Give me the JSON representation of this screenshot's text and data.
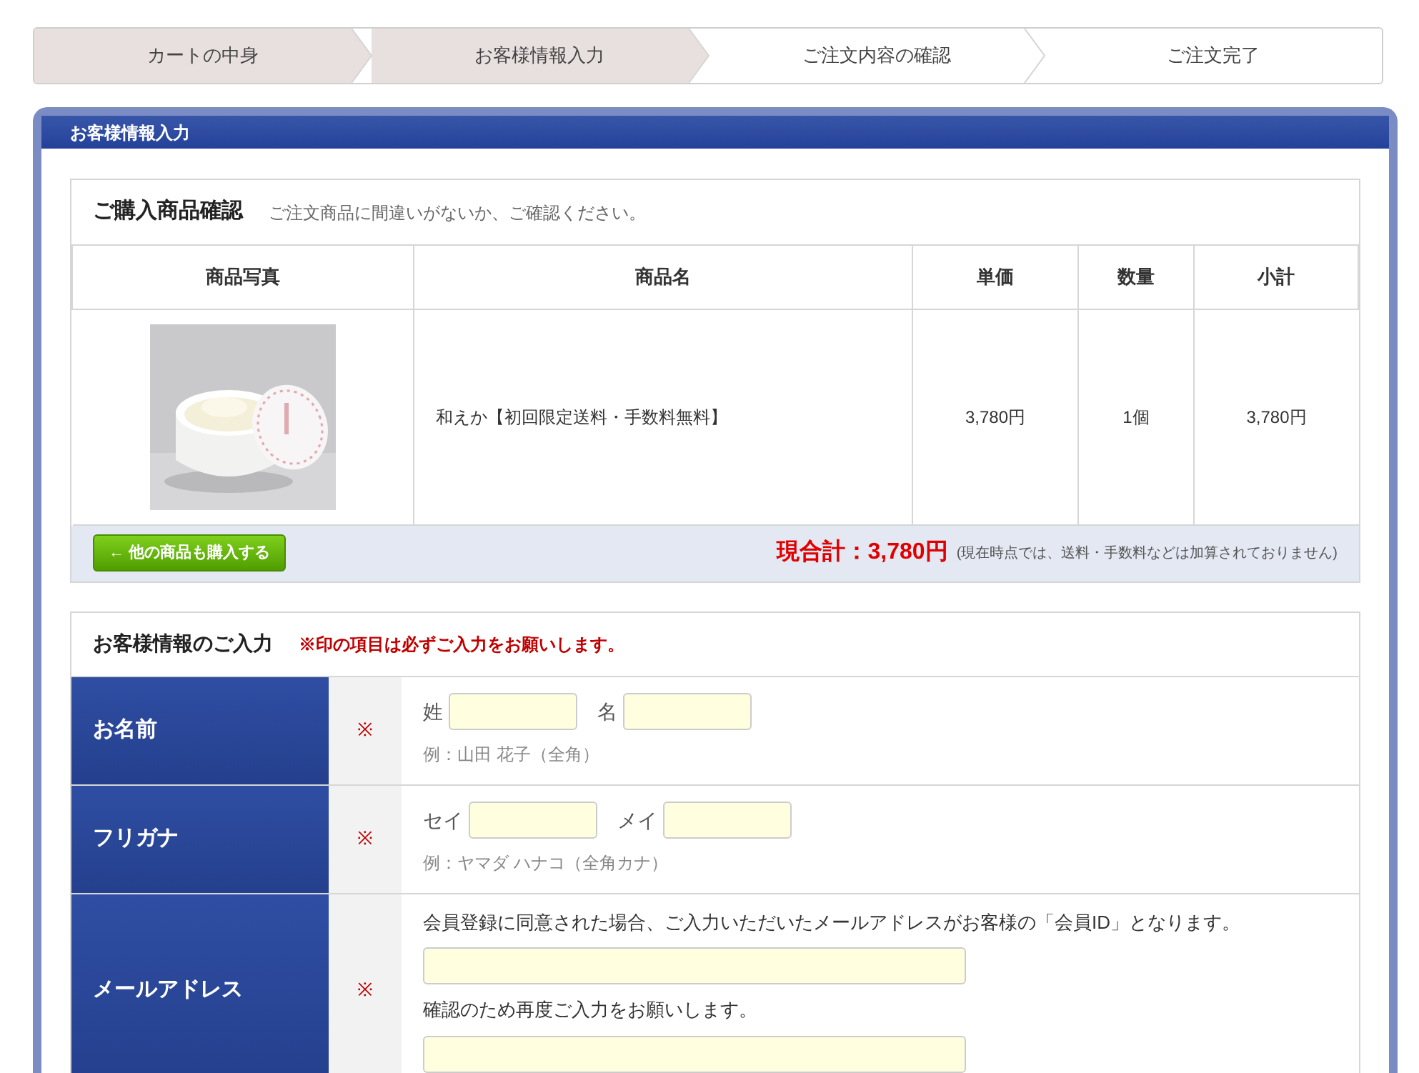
{
  "steps": [
    {
      "label": "カートの中身",
      "reached": true
    },
    {
      "label": "お客様情報入力",
      "reached": true
    },
    {
      "label": "ご注文内容の確認",
      "reached": false
    },
    {
      "label": "ご注文完了",
      "reached": false
    }
  ],
  "panel": {
    "title": "お客様情報入力"
  },
  "purchase": {
    "title": "ご購入商品確認",
    "subtitle": "ご注文商品に間違いがないか、ご確認ください。",
    "columns": [
      "商品写真",
      "商品名",
      "単価",
      "数量",
      "小計"
    ],
    "rows": [
      {
        "name": "和えか【初回限定送料・手数料無料】",
        "price": "3,780円",
        "quantity": "1個",
        "subtotal": "3,780円"
      }
    ],
    "back_button": "← 他の商品も購入する",
    "total": "現合計：3,780円",
    "total_note": "(現在時点では、送料・手数料などは加算されておりません)"
  },
  "customer": {
    "title": "お客様情報のご入力",
    "notice": "※印の項目は必ずご入力をお願いします。",
    "rows": [
      {
        "label": "お名前",
        "required_mark": "※",
        "lines": [
          {
            "kind": "pair",
            "fields": [
              {
                "label": "姓"
              },
              {
                "label": "名"
              }
            ]
          },
          {
            "kind": "hint",
            "text": "例：山田 花子（全角）"
          }
        ]
      },
      {
        "label": "フリガナ",
        "required_mark": "※",
        "lines": [
          {
            "kind": "pair",
            "fields": [
              {
                "label": "セイ"
              },
              {
                "label": "メイ"
              }
            ]
          },
          {
            "kind": "hint",
            "text": "例：ヤマダ ハナコ（全角カナ）"
          }
        ]
      },
      {
        "label": "メールアドレス",
        "required_mark": "※",
        "lines": [
          {
            "kind": "note",
            "text": "会員登録に同意された場合、ご入力いただいたメールアドレスがお客様の「会員ID」となります。"
          },
          {
            "kind": "field"
          },
          {
            "kind": "note",
            "text": "確認のため再度ご入力をお願いします。"
          },
          {
            "kind": "field"
          }
        ]
      }
    ]
  }
}
